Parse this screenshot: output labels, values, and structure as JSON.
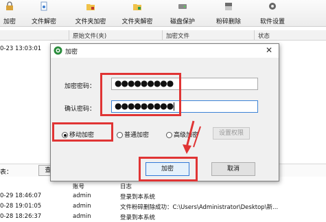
{
  "toolbar": {
    "items": [
      {
        "label": "加密",
        "icon": "encrypt-icon"
      },
      {
        "label": "文件解密",
        "icon": "file-decrypt-icon"
      },
      {
        "label": "文件夹加密",
        "icon": "folder-encrypt-icon"
      },
      {
        "label": "文件夹解密",
        "icon": "folder-decrypt-icon"
      },
      {
        "label": "磁盘保护",
        "icon": "disk-protect-icon"
      },
      {
        "label": "粉碎删除",
        "icon": "shred-icon"
      },
      {
        "label": "软件设置",
        "icon": "gear-icon"
      }
    ]
  },
  "file_list": {
    "columns": [
      "原始文件(夹)",
      "加密文件",
      "状态"
    ],
    "rows": [
      {
        "time": "0-23 13:03:01"
      }
    ]
  },
  "bottom": {
    "label": "表：",
    "query_button": "查"
  },
  "log": {
    "columns": [
      "账号",
      "日志"
    ],
    "rows": [
      {
        "time": "0-29 18:46:07",
        "user": "admin",
        "message": "登录到本系统"
      },
      {
        "time": "0-28 19:01:05",
        "user": "admin",
        "message": "文件粉碎删除成功：C:\\Users\\Administrator\\Desktop\\新..."
      },
      {
        "time": "0-28 18:26:37",
        "user": "admin",
        "message": "登录到本系统"
      }
    ]
  },
  "dialog": {
    "title": "加密",
    "password_label": "加密密码：",
    "password_value": "●●●●●●●●●",
    "confirm_label": "确认密码：",
    "confirm_value": "●●●●●●●●●",
    "modes": [
      {
        "label": "移动加密",
        "selected": true
      },
      {
        "label": "普通加密",
        "selected": false
      },
      {
        "label": "高级加密",
        "selected": false
      }
    ],
    "permissions_button": "设置权限",
    "ok_button": "加密",
    "cancel_button": "取消"
  },
  "colors": {
    "highlight": "#e03434",
    "focus_border": "#3b82d6",
    "dialog_bg": "#f0f0f0"
  }
}
